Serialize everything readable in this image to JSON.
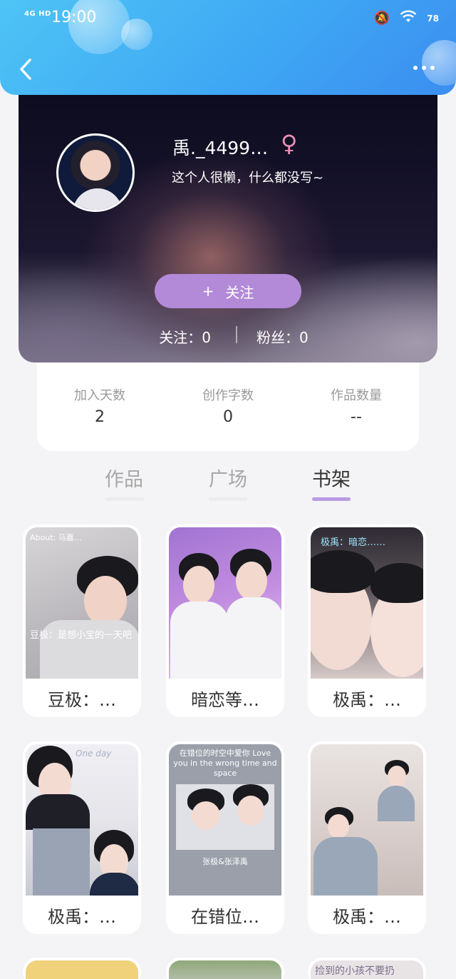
{
  "status_bar": {
    "network": "4G HD",
    "time": "19:00",
    "battery": "78"
  },
  "profile": {
    "username": "禹._4499…",
    "gender_symbol": "♀",
    "bio": "这个人很懒，什么都没写~",
    "follow_button": {
      "icon": "+",
      "label": "关注"
    },
    "following": "关注：0",
    "followers": "粉丝：0"
  },
  "stats": [
    {
      "label": "加入天数",
      "value": "2"
    },
    {
      "label": "创作字数",
      "value": "0"
    },
    {
      "label": "作品数量",
      "value": "--"
    }
  ],
  "tabs": [
    {
      "label": "作品",
      "active": false
    },
    {
      "label": "广场",
      "active": false
    },
    {
      "label": "书架",
      "active": true
    }
  ],
  "books": [
    {
      "title": "豆极：…",
      "cover_text": "About: 马嘉…",
      "cover_caption": "豆极：是想小宝的一天吧"
    },
    {
      "title": "暗恋等…"
    },
    {
      "title": "极禹：…",
      "cover_text": "极禹：暗恋……"
    },
    {
      "title": "极禹：…",
      "cover_text": "One day"
    },
    {
      "title": "在错位…",
      "cover_text": "在错位的时空中爱你 Love you in the wrong time and space",
      "cover_caption": "张极&张泽禹"
    },
    {
      "title": "极禹：…"
    }
  ],
  "partial_row_text": "捡到的小孩不要扔",
  "colors": {
    "header": "#3fa8f4",
    "accent": "#b38ad8",
    "tab_indicator": "#b89be0"
  }
}
